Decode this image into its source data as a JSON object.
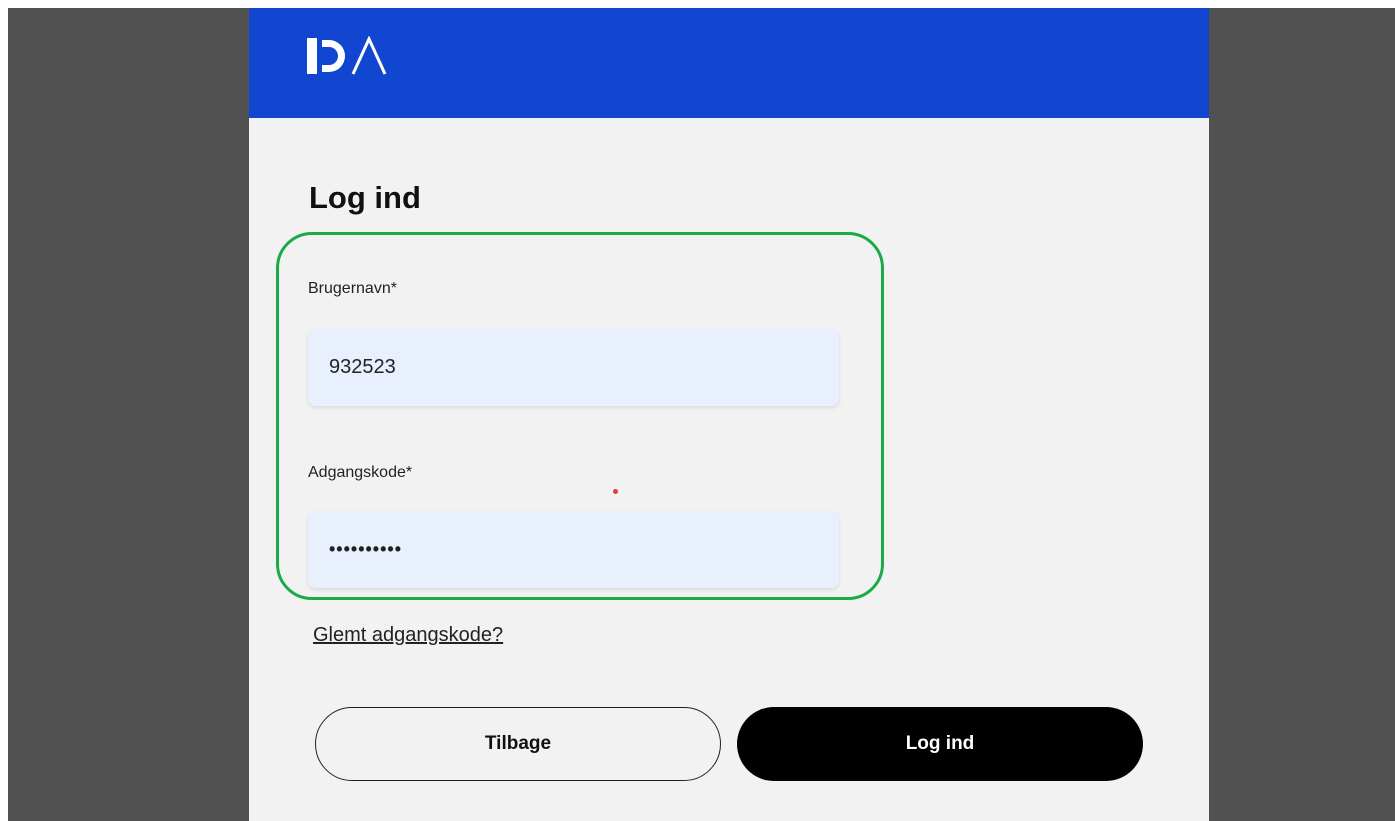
{
  "header": {
    "brand_color": "#1146d0",
    "logo_text": "IDA"
  },
  "login": {
    "title": "Log ind",
    "highlight_color": "#1aaa47",
    "username": {
      "label": "Brugernavn*",
      "value": "932523"
    },
    "password": {
      "label": "Adgangskode*",
      "masked_value": "••••••••••"
    },
    "forgot_link": "Glemt adgangskode?",
    "back_button": "Tilbage",
    "submit_button": "Log ind"
  }
}
